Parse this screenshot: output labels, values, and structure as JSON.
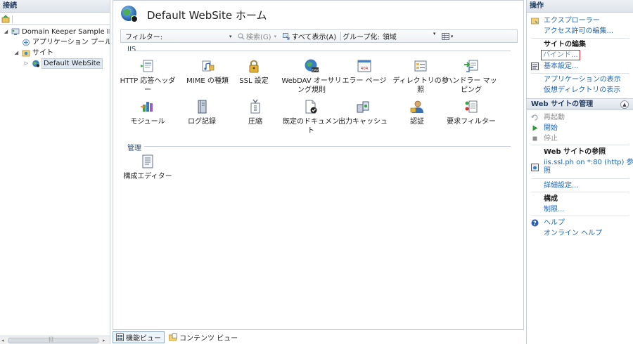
{
  "connections": {
    "header": "接続",
    "tree": [
      {
        "label": "Domain Keeper Sample IIS",
        "expander": "◢"
      },
      {
        "label": "アプリケーション プール",
        "expander": ""
      },
      {
        "label": "サイト",
        "expander": "◢"
      },
      {
        "label": "Default WebSite",
        "expander": "▷"
      }
    ],
    "scroll_left": "◂",
    "scroll_right": "▸",
    "scroll_grip": "|||"
  },
  "center": {
    "title": "Default WebSite ホーム",
    "filter_label": "フィルター:",
    "search_label": "検索(G)",
    "show_all_label": "すべて表示(A)",
    "group_label": "グループ化:",
    "group_value": "領域",
    "dropdown_arrow": "▾",
    "sections": {
      "iis": "IIS",
      "management": "管理"
    },
    "features": [
      {
        "label": "HTTP 応答ヘッダー"
      },
      {
        "label": "MIME の種類"
      },
      {
        "label": "SSL 設定"
      },
      {
        "label": "WebDAV オーサリング規則"
      },
      {
        "label": "エラー ページ"
      },
      {
        "label": "ディレクトリの参照"
      },
      {
        "label": "ハンドラー マッピング"
      },
      {
        "label": "モジュール"
      },
      {
        "label": "ログ記録"
      },
      {
        "label": "圧縮"
      },
      {
        "label": "既定のドキュメント"
      },
      {
        "label": "出力キャッシュ"
      },
      {
        "label": "認証"
      },
      {
        "label": "要求フィルター"
      }
    ],
    "management_features": [
      {
        "label": "構成エディター"
      }
    ],
    "view_tabs": {
      "features_view": "機能ビュー",
      "content_view": "コンテンツ ビュー"
    }
  },
  "actions": {
    "header": "操作",
    "explore": "エクスプローラー",
    "edit_permissions": "アクセス許可の編集...",
    "edit_site_heading": "サイトの編集",
    "bindings": "バインド...",
    "basic_settings": "基本設定...",
    "view_applications": "アプリケーションの表示",
    "view_virtual_dirs": "仮想ディレクトリの表示",
    "manage_site_heading": "Web サイトの管理",
    "collapse_glyph": "▲",
    "restart": "再起動",
    "start": "開始",
    "stop": "停止",
    "browse_heading": "Web サイトの参照",
    "browse_link_line1": "iis.ssl.ph on *:80 (http) 参",
    "browse_link_line2": "照",
    "advanced_settings": "詳細設定...",
    "config_heading": "構成",
    "limits": "制限...",
    "help": "ヘルプ",
    "online_help": "オンライン ヘルプ"
  }
}
